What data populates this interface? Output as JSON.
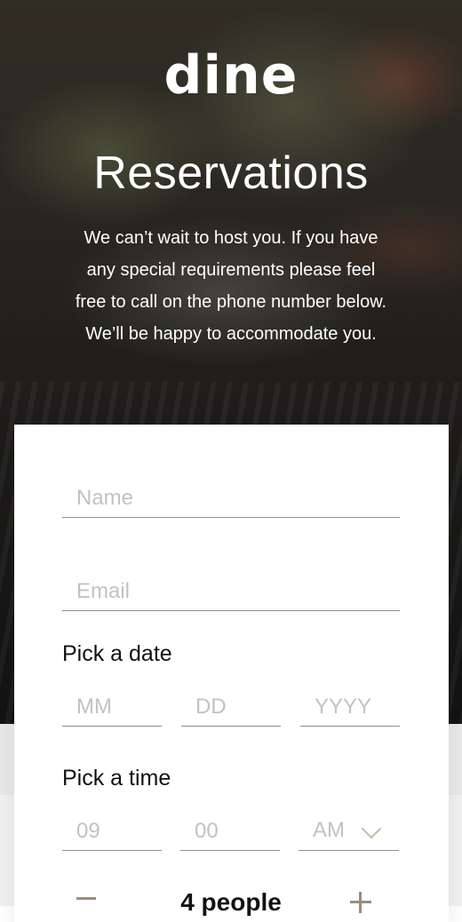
{
  "brand": {
    "logo": "dine"
  },
  "header": {
    "title": "Reservations",
    "intro": [
      "We can’t wait to host you. If you have",
      "any special requirements please feel",
      "free to call on the phone number below.",
      "We’ll be happy to accommodate you."
    ]
  },
  "form": {
    "name_placeholder": "Name",
    "email_placeholder": "Email",
    "date": {
      "label": "Pick a date",
      "month_placeholder": "MM",
      "day_placeholder": "DD",
      "year_placeholder": "YYYY"
    },
    "time": {
      "label": "Pick a time",
      "hour_placeholder": "09",
      "minute_placeholder": "00",
      "period_value": "AM"
    },
    "people": {
      "minus_label": "−",
      "count_label": "4 people",
      "plus_label": "+"
    }
  },
  "icons": {
    "period_chevron": "chevron-down-icon",
    "minus": "minus-icon",
    "plus": "plus-icon"
  },
  "colors": {
    "accent": "#9b8d80",
    "chevron": "#c8b9ab",
    "placeholder": "#c2c2c2",
    "text": "#111111"
  }
}
